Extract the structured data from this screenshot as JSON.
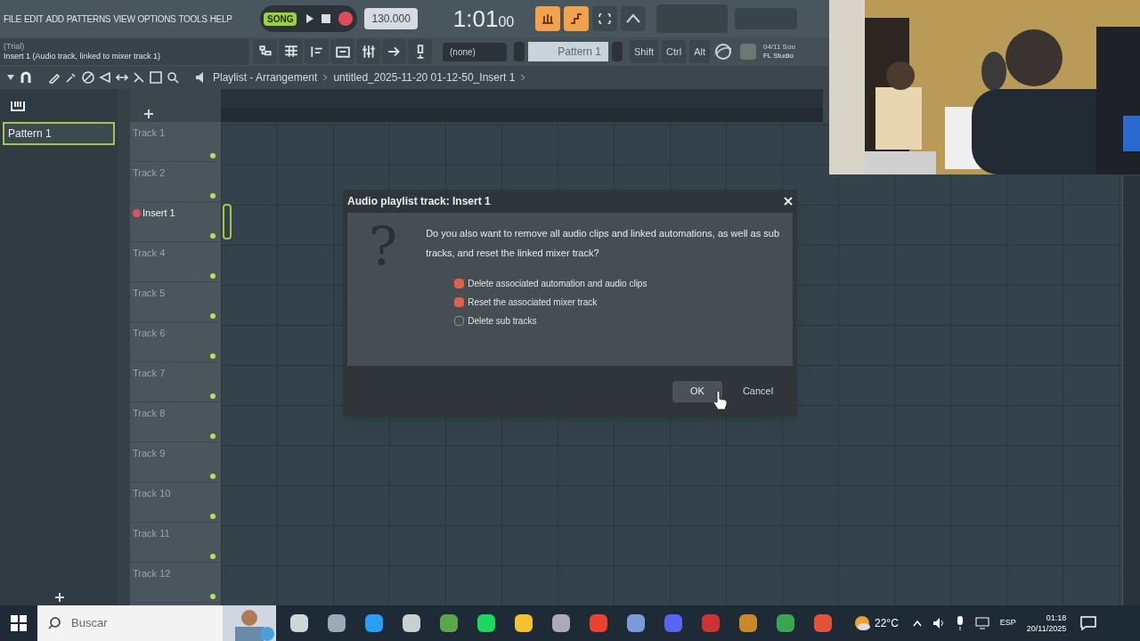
{
  "menu": [
    "FILE",
    "EDIT",
    "ADD",
    "PATTERNS",
    "VIEW",
    "OPTIONS",
    "TOOLS",
    "HELP"
  ],
  "transport": {
    "mode": "SONG",
    "tempo": "130.000",
    "time": "1:01",
    "time_ticks": "00"
  },
  "hint": {
    "line_1": "(Trial)",
    "line_2": "Insert 1 (Audio track, linked to mixer track 1)"
  },
  "toolbar": {
    "channel": "(none)",
    "pattern": "Pattern 1",
    "modifiers": [
      "Shift",
      "Ctrl",
      "Alt"
    ],
    "info": [
      "04/11 Sou",
      "FL Studio"
    ]
  },
  "breadcrumb": [
    "Playlist - Arrangement",
    "untitled_2025-11-20 01-12-50_Insert 1"
  ],
  "patterns": [
    {
      "name": "Pattern 1",
      "selected": true
    }
  ],
  "tracks": [
    {
      "name": "Track 1",
      "selected": false
    },
    {
      "name": "Track 2",
      "selected": false
    },
    {
      "name": "Insert 1",
      "selected": true
    },
    {
      "name": "Track 4",
      "selected": false
    },
    {
      "name": "Track 5",
      "selected": false
    },
    {
      "name": "Track 6",
      "selected": false
    },
    {
      "name": "Track 7",
      "selected": false
    },
    {
      "name": "Track 8",
      "selected": false
    },
    {
      "name": "Track 9",
      "selected": false
    },
    {
      "name": "Track 10",
      "selected": false
    },
    {
      "name": "Track 11",
      "selected": false
    },
    {
      "name": "Track 12",
      "selected": false
    }
  ],
  "dialog": {
    "title": "Audio playlist track: Insert 1",
    "icon": "?",
    "message": "Do you also want to remove all audio clips and linked automations, as well as sub tracks, and reset the linked mixer track?",
    "options": [
      {
        "label": "Delete associated automation and audio clips",
        "checked": true
      },
      {
        "label": "Reset the associated mixer track",
        "checked": true
      },
      {
        "label": "Delete sub tracks",
        "checked": false
      }
    ],
    "buttons": [
      {
        "label": "OK",
        "default": true
      },
      {
        "label": "Cancel",
        "default": false
      }
    ]
  },
  "taskbar": {
    "search_placeholder": "Buscar",
    "weather": "22°C",
    "language": "ESP",
    "time": "01:18",
    "date": "20/11/2025"
  }
}
